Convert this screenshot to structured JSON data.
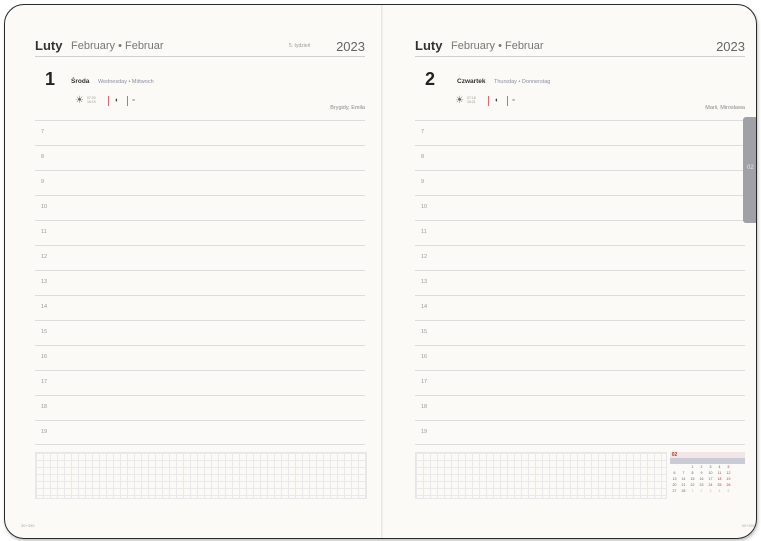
{
  "left": {
    "month": "Luty",
    "month_alt": "February • Februar",
    "week": "5. tydzień",
    "year": "2023",
    "day_num": "1",
    "day_name": "Środa",
    "day_alt": "Wednesday • Mittwoch",
    "sun_times": [
      "07:20",
      "16:19"
    ],
    "namesday": "Brygidy, Emila",
    "hours": [
      "7",
      "8",
      "9",
      "10",
      "11",
      "12",
      "13",
      "14",
      "15",
      "16",
      "17",
      "18",
      "19"
    ],
    "page_num": "30+330"
  },
  "right": {
    "month": "Luty",
    "month_alt": "February • Februar",
    "year": "2023",
    "day_num": "2",
    "day_name": "Czwartek",
    "day_alt": "Thursday • Donnerstag",
    "sun_times": [
      "07:18",
      "16:21"
    ],
    "namesday": "Marii, Mirosława",
    "hours": [
      "7",
      "8",
      "9",
      "10",
      "11",
      "12",
      "13",
      "14",
      "15",
      "16",
      "17",
      "18",
      "19"
    ],
    "page_num": "30+330"
  },
  "mini_calendar": {
    "month": "02",
    "rows": [
      [
        "",
        "",
        "1",
        "2",
        "3",
        "4",
        "5"
      ],
      [
        "6",
        "7",
        "8",
        "9",
        "10",
        "11",
        "12"
      ],
      [
        "13",
        "14",
        "15",
        "16",
        "17",
        "18",
        "19"
      ],
      [
        "20",
        "21",
        "22",
        "23",
        "24",
        "25",
        "26"
      ],
      [
        "27",
        "28",
        "1",
        "2",
        "3",
        "4",
        "5"
      ]
    ]
  },
  "side_tab": "02",
  "colors": {
    "paper": "#fbfaf6",
    "accent_red": "#d86a6a",
    "tab": "#9fa1a7"
  }
}
